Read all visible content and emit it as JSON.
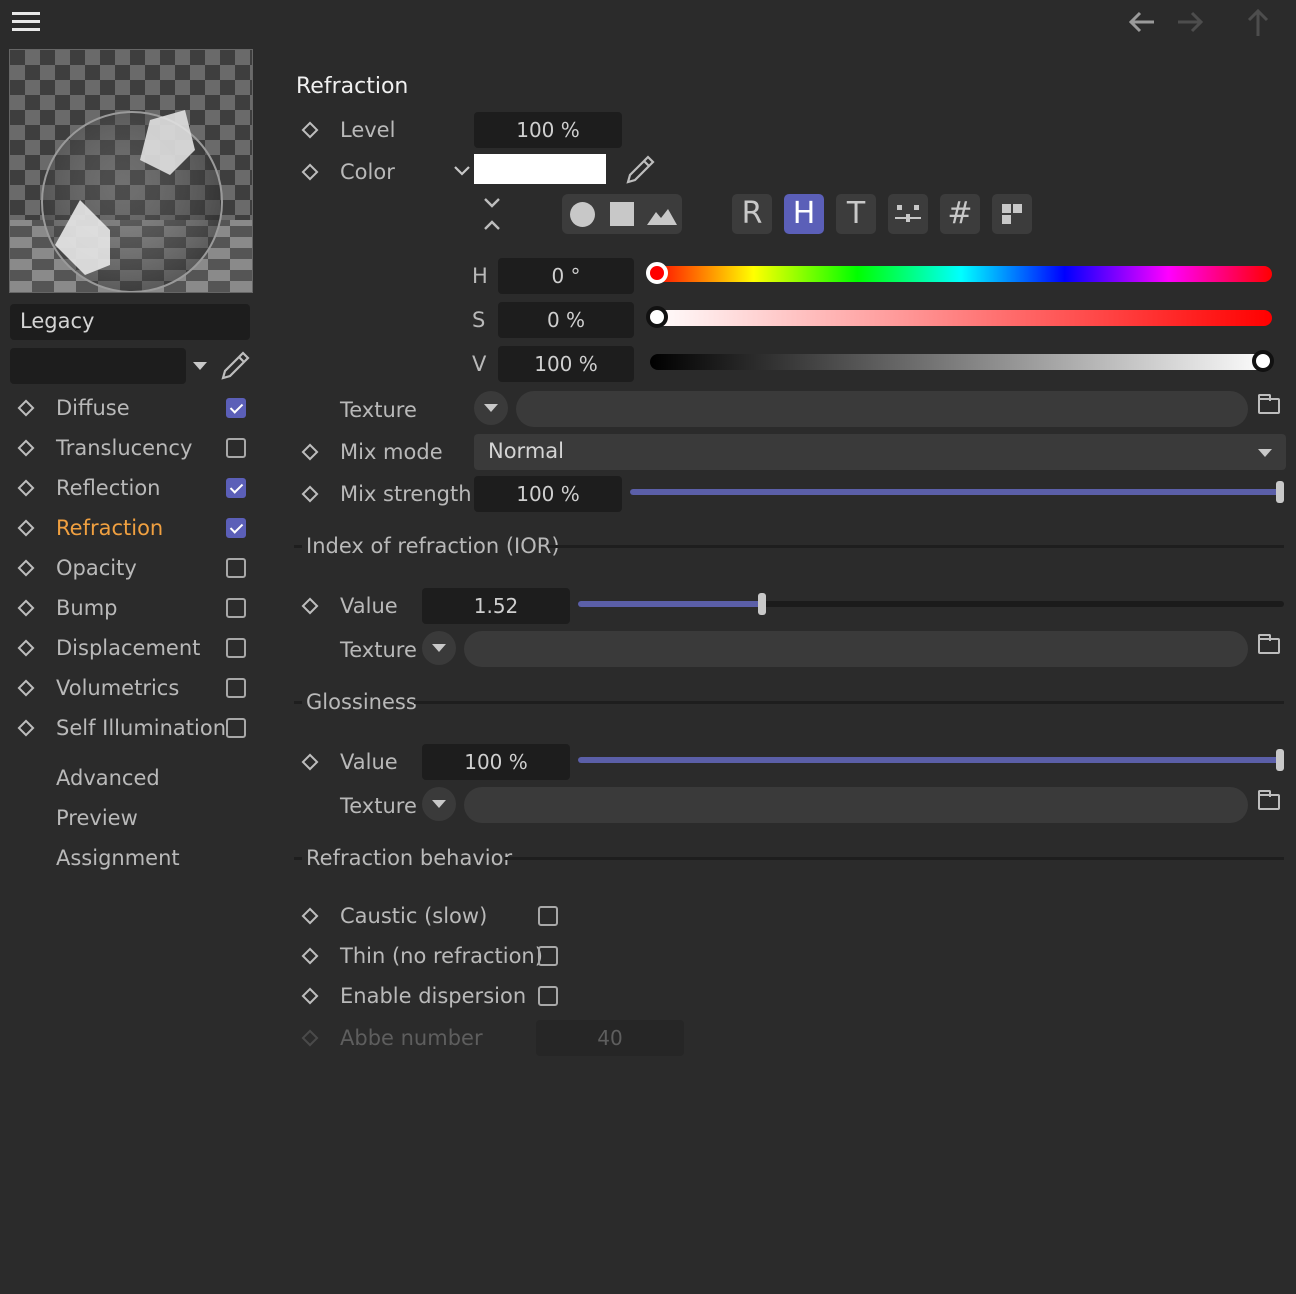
{
  "toolbar": {
    "menu_icon": "hamburger-icon",
    "back_icon": "arrow-left-icon",
    "forward_icon": "arrow-right-icon",
    "up_icon": "arrow-up-icon"
  },
  "sidebar": {
    "preset": "Legacy",
    "channels": [
      {
        "label": "Diffuse",
        "checked": true
      },
      {
        "label": "Translucency",
        "checked": false
      },
      {
        "label": "Reflection",
        "checked": true
      },
      {
        "label": "Refraction",
        "checked": true,
        "active": true
      },
      {
        "label": "Opacity",
        "checked": false
      },
      {
        "label": "Bump",
        "checked": false
      },
      {
        "label": "Displacement",
        "checked": false
      },
      {
        "label": "Volumetrics",
        "checked": false
      },
      {
        "label": "Self Illumination",
        "checked": false
      }
    ],
    "extra": [
      "Advanced",
      "Preview",
      "Assignment"
    ]
  },
  "main": {
    "title": "Refraction",
    "level_label": "Level",
    "level_value": "100 %",
    "color_label": "Color",
    "color_swatch": "#ffffff",
    "modes": [
      "R",
      "H",
      "T",
      "#"
    ],
    "hsv": {
      "h_label": "H",
      "h_value": "0 °",
      "s_label": "S",
      "s_value": "0 %",
      "v_label": "V",
      "v_value": "100 %"
    },
    "texture_label": "Texture",
    "mix_mode_label": "Mix mode",
    "mix_mode_value": "Normal",
    "mix_strength_label": "Mix strength",
    "mix_strength_value": "100 %",
    "mix_strength_fraction": 1.0,
    "ior": {
      "section": "Index of refraction (IOR)",
      "value_label": "Value",
      "value": "1.52",
      "fraction": 0.26,
      "texture_label": "Texture"
    },
    "glossiness": {
      "section": "Glossiness",
      "value_label": "Value",
      "value": "100 %",
      "fraction": 1.0,
      "texture_label": "Texture"
    },
    "behavior": {
      "section": "Refraction behavior",
      "caustic": "Caustic (slow)",
      "thin": "Thin (no refraction)",
      "dispersion": "Enable dispersion",
      "abbe_label": "Abbe number",
      "abbe_value": "40"
    }
  },
  "colors": {
    "accent": "#5b5fb8",
    "active_label": "#f0a040"
  }
}
